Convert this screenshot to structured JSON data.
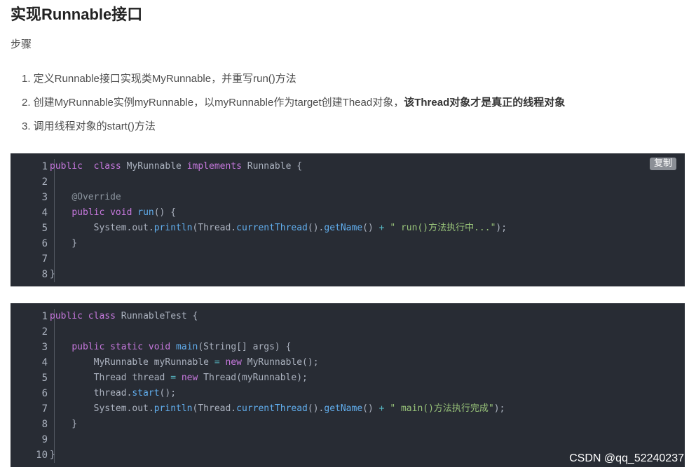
{
  "heading": "实现Runnable接口",
  "subheading": "步骤",
  "steps": [
    {
      "text": "1. 定义Runnable接口实现类MyRunnable，并重写run()方法",
      "bold": ""
    },
    {
      "text": "2. 创建MyRunnable实例myRunnable，以myRunnable作为target创建Thead对象，",
      "bold": "该Thread对象才是真正的线程对象"
    },
    {
      "text": "3. 调用线程对象的start()方法",
      "bold": ""
    }
  ],
  "copy_label": "复制",
  "code_blocks": [
    {
      "numbers": [
        "1",
        "2",
        "3",
        "4",
        "5",
        "6",
        "7",
        "8"
      ],
      "lines": [
        [
          [
            "kw",
            "public"
          ],
          [
            "",
            "  "
          ],
          [
            "kw",
            "class"
          ],
          [
            "",
            " MyRunnable "
          ],
          [
            "kw",
            "implements"
          ],
          [
            "",
            " Runnable {"
          ]
        ],
        [],
        [
          [
            "",
            "    "
          ],
          [
            "anno",
            "@Override"
          ]
        ],
        [
          [
            "",
            "    "
          ],
          [
            "kw",
            "public"
          ],
          [
            "",
            " "
          ],
          [
            "kw",
            "void"
          ],
          [
            "",
            " "
          ],
          [
            "fn",
            "run"
          ],
          [
            "",
            "() {"
          ]
        ],
        [
          [
            "",
            "        System.out."
          ],
          [
            "fn",
            "println"
          ],
          [
            "",
            "(Thread."
          ],
          [
            "fn",
            "currentThread"
          ],
          [
            "",
            "()."
          ],
          [
            "fn",
            "getName"
          ],
          [
            "",
            "() "
          ],
          [
            "op",
            "+"
          ],
          [
            "",
            " "
          ],
          [
            "str",
            "\" run()方法执行中...\""
          ],
          [
            "",
            ");"
          ]
        ],
        [
          [
            "",
            "    }"
          ]
        ],
        [],
        [
          [
            "",
            "}"
          ]
        ]
      ]
    },
    {
      "numbers": [
        "1",
        "2",
        "3",
        "4",
        "5",
        "6",
        "7",
        "8",
        "9",
        "10"
      ],
      "lines": [
        [
          [
            "kw",
            "public"
          ],
          [
            "",
            " "
          ],
          [
            "kw",
            "class"
          ],
          [
            "",
            " RunnableTest {"
          ]
        ],
        [],
        [
          [
            "",
            "    "
          ],
          [
            "kw",
            "public"
          ],
          [
            "",
            " "
          ],
          [
            "kw",
            "static"
          ],
          [
            "",
            " "
          ],
          [
            "kw",
            "void"
          ],
          [
            "",
            " "
          ],
          [
            "fn",
            "main"
          ],
          [
            "",
            "(String[] args) {"
          ]
        ],
        [
          [
            "",
            "        MyRunnable myRunnable "
          ],
          [
            "op",
            "="
          ],
          [
            "",
            " "
          ],
          [
            "kw",
            "new"
          ],
          [
            "",
            " MyRunnable();"
          ]
        ],
        [
          [
            "",
            "        Thread thread "
          ],
          [
            "op",
            "="
          ],
          [
            "",
            " "
          ],
          [
            "kw",
            "new"
          ],
          [
            "",
            " Thread(myRunnable);"
          ]
        ],
        [
          [
            "",
            "        thread."
          ],
          [
            "fn",
            "start"
          ],
          [
            "",
            "();"
          ]
        ],
        [
          [
            "",
            "        System.out."
          ],
          [
            "fn",
            "println"
          ],
          [
            "",
            "(Thread."
          ],
          [
            "fn",
            "currentThread"
          ],
          [
            "",
            "()."
          ],
          [
            "fn",
            "getName"
          ],
          [
            "",
            "() "
          ],
          [
            "op",
            "+"
          ],
          [
            "",
            " "
          ],
          [
            "str",
            "\" main()方法执行完成\""
          ],
          [
            "",
            ");"
          ]
        ],
        [
          [
            "",
            "    }"
          ]
        ],
        [],
        [
          [
            "",
            "}"
          ]
        ]
      ]
    }
  ],
  "watermark": "CSDN @qq_52240237"
}
